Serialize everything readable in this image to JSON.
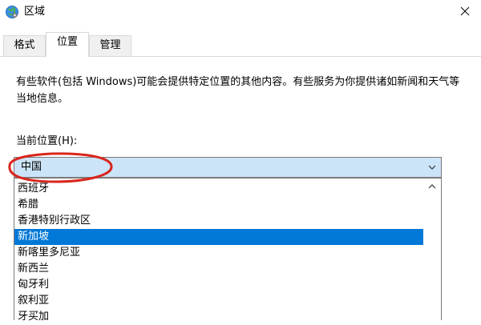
{
  "window": {
    "title": "区域",
    "close_icon": "close-icon",
    "app_icon": "globe-icon"
  },
  "tabs": [
    {
      "label": "格式",
      "active": false
    },
    {
      "label": "位置",
      "active": true
    },
    {
      "label": "管理",
      "active": false
    }
  ],
  "location_tab": {
    "description": "有些软件(包括 Windows)可能会提供特定位置的其他内容。有些服务为你提供诸如新闻和天气等当地信息。",
    "current_location_label": "当前位置(H):",
    "selected_value": "中国",
    "dropdown_icon": "chevron-down-icon",
    "list": [
      {
        "label": "西班牙",
        "selected": false
      },
      {
        "label": "希腊",
        "selected": false
      },
      {
        "label": "香港特别行政区",
        "selected": false
      },
      {
        "label": "新加坡",
        "selected": true
      },
      {
        "label": "新喀里多尼亚",
        "selected": false
      },
      {
        "label": "新西兰",
        "selected": false
      },
      {
        "label": "匈牙利",
        "selected": false
      },
      {
        "label": "叙利亚",
        "selected": false
      },
      {
        "label": "牙买加",
        "selected": false
      }
    ]
  },
  "colors": {
    "highlight": "#0078d7",
    "combo_focus": "#cce4f7",
    "annotation": "#d9261c"
  }
}
